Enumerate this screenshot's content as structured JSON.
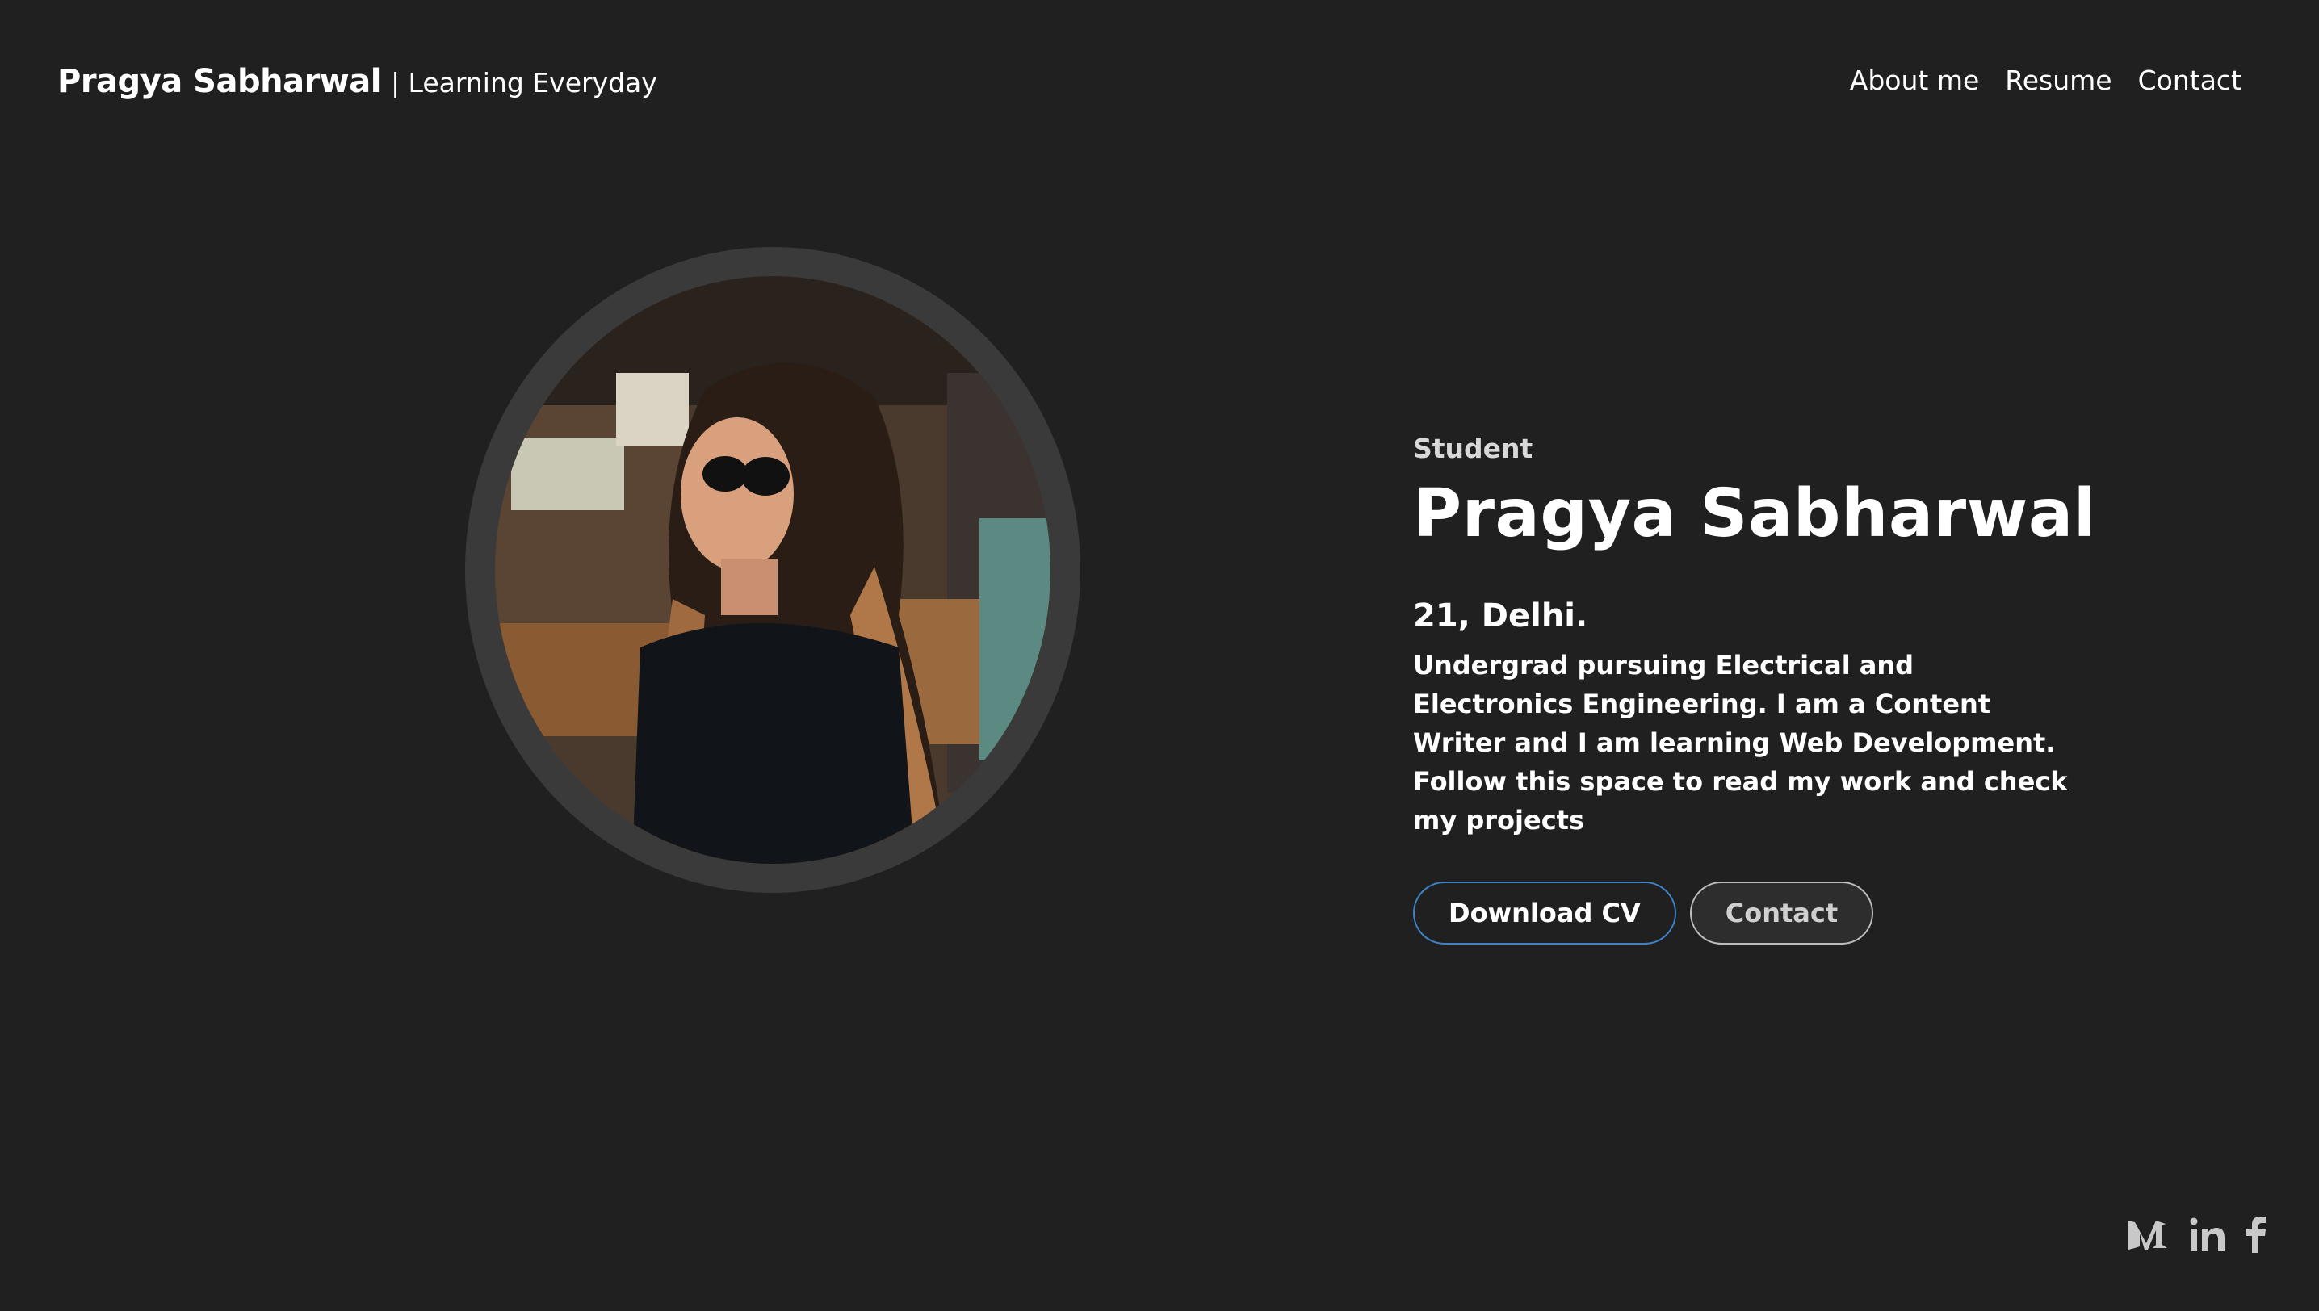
{
  "header": {
    "brand_name": "Pragya Sabharwal",
    "brand_tagline": "| Learning Everyday",
    "nav": [
      {
        "label": "About me"
      },
      {
        "label": "Resume"
      },
      {
        "label": "Contact"
      }
    ]
  },
  "hero": {
    "role": "Student",
    "name": "Pragya Sabharwal",
    "meta": "21, Delhi.",
    "bio": "Undergrad pursuing Electrical and Electronics Engineering. I am a Content Writer and I am learning Web Development. Follow this space to read my work and check my projects",
    "primary_button": "Download CV",
    "secondary_button": "Contact"
  },
  "social": [
    {
      "icon": "medium-icon"
    },
    {
      "icon": "linkedin-icon"
    },
    {
      "icon": "facebook-icon"
    }
  ],
  "colors": {
    "background": "#202020",
    "avatar_ring": "#3a3a3a",
    "primary_button_border": "#3f82c7",
    "secondary_button_border": "#bdbdbd"
  }
}
